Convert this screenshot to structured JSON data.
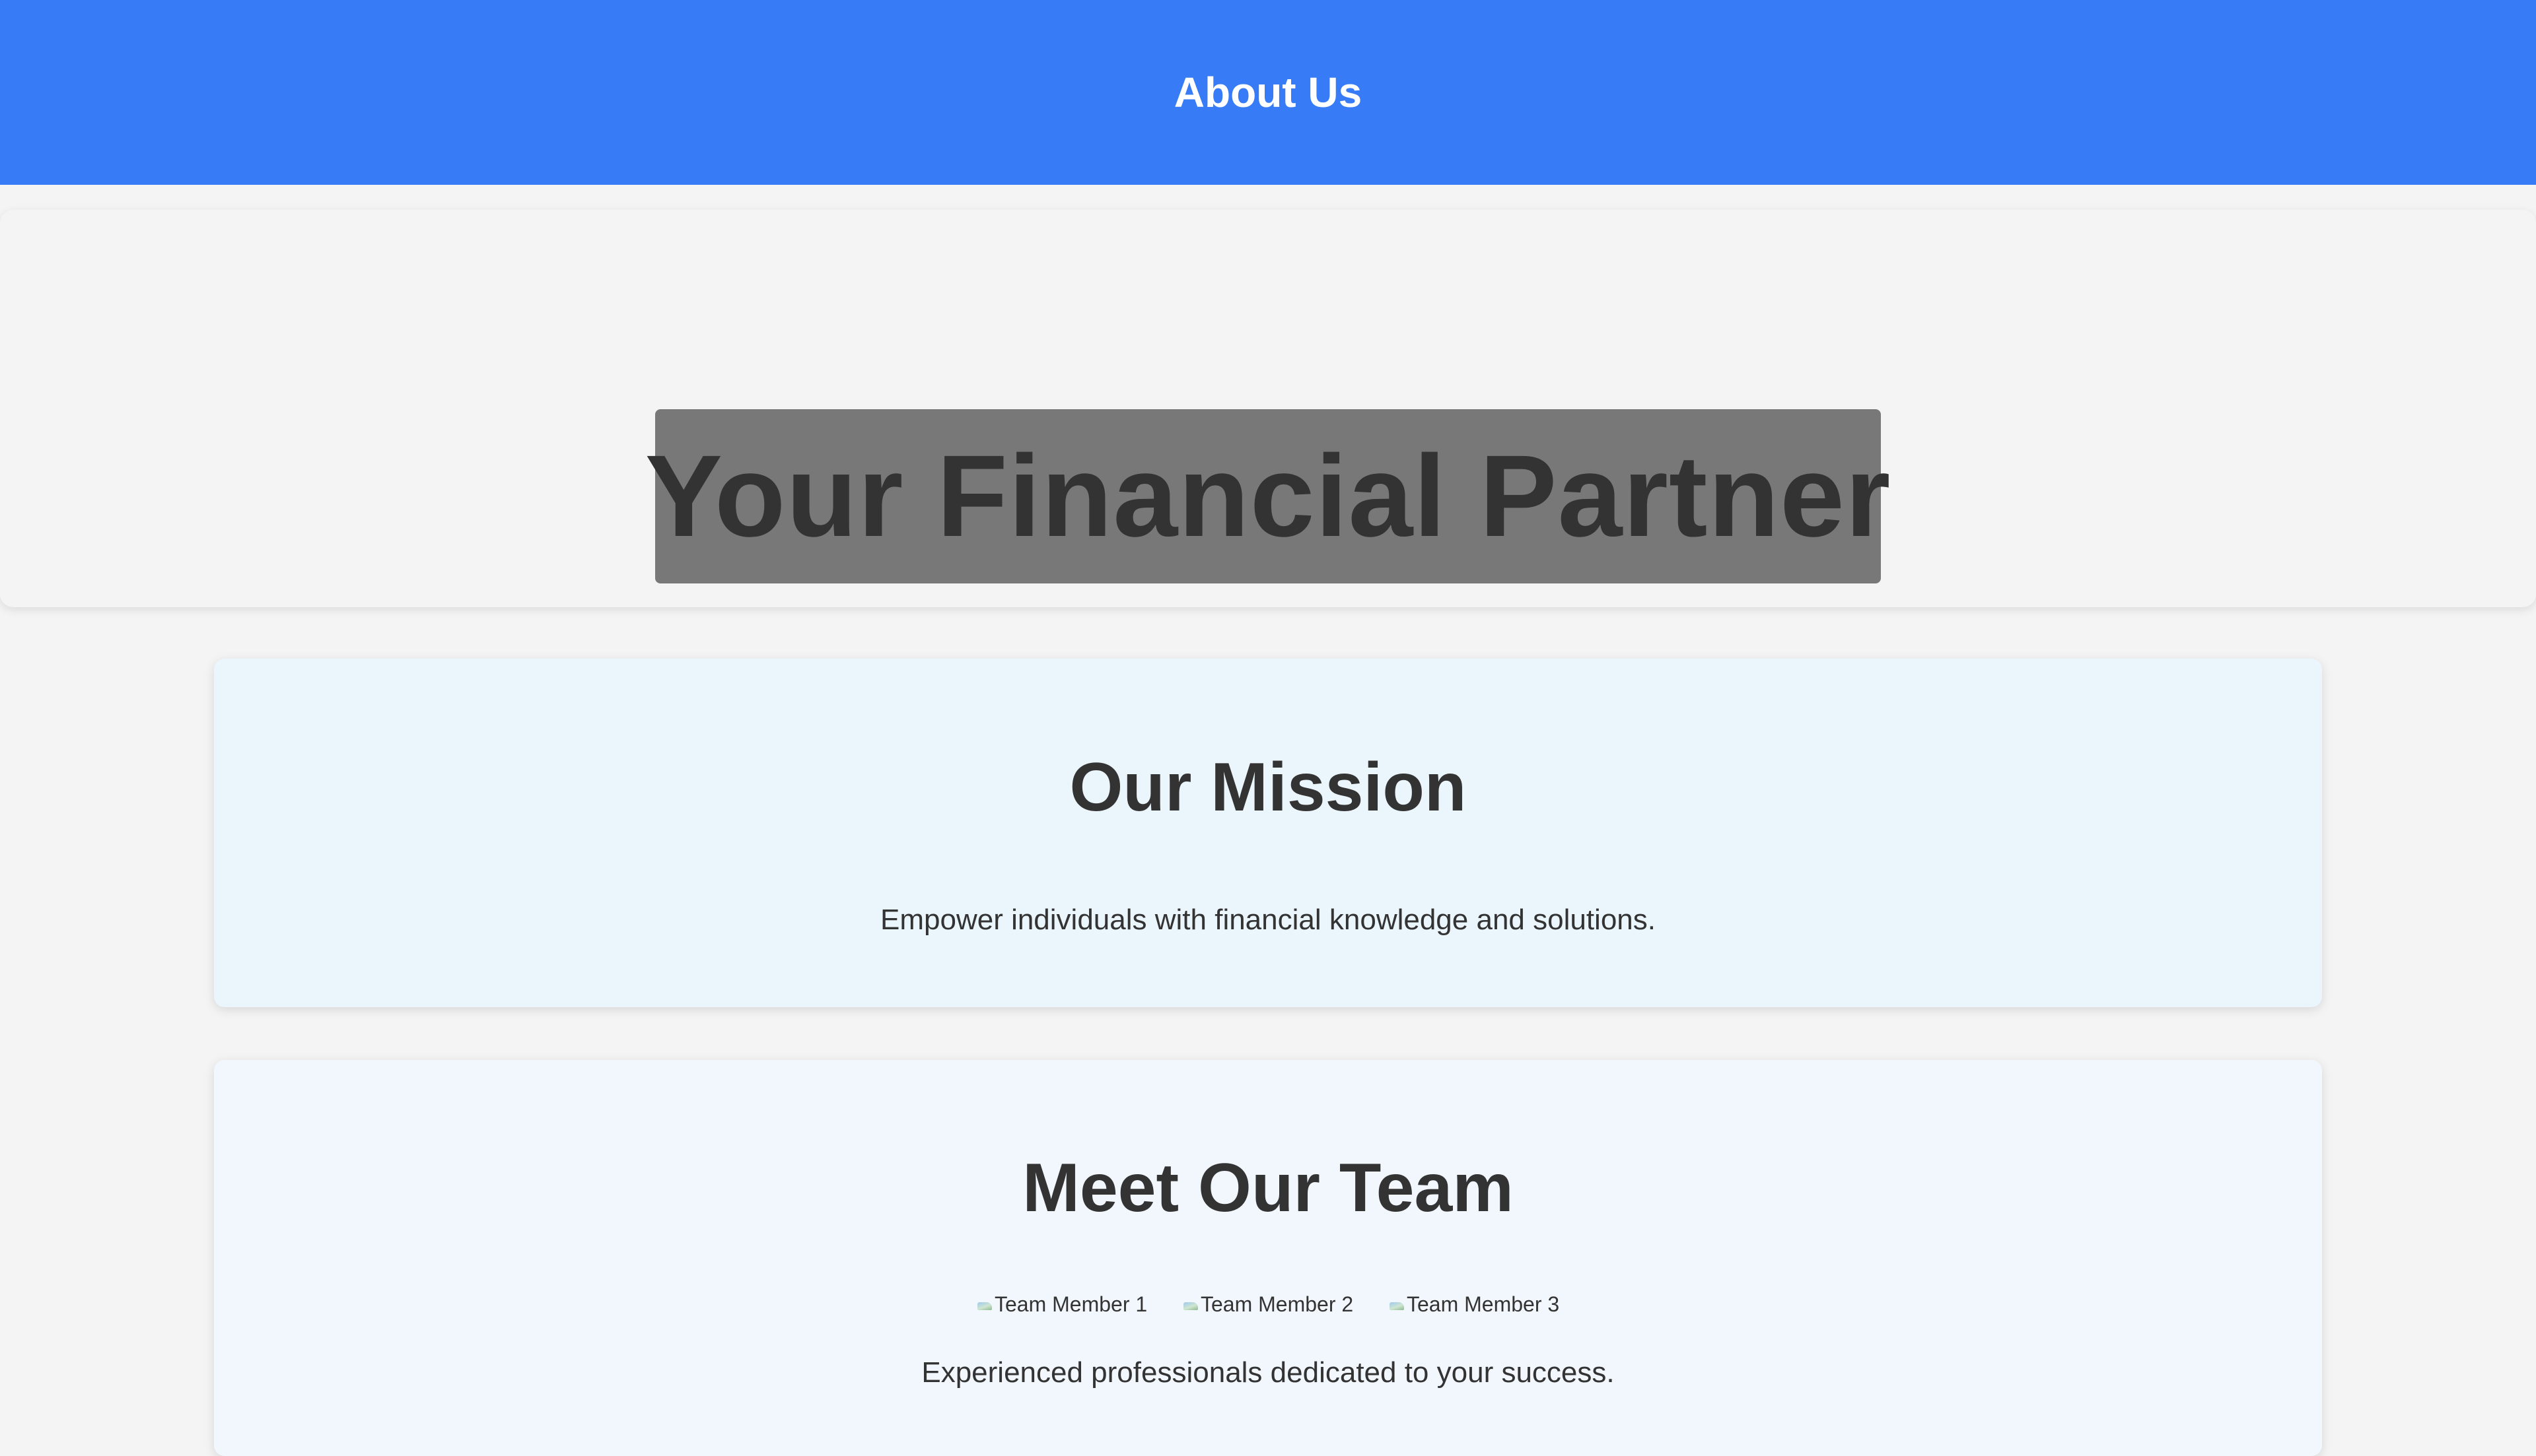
{
  "header": {
    "title": "About Us"
  },
  "hero": {
    "title": "Your Financial Partner"
  },
  "mission": {
    "heading": "Our Mission",
    "text": "Empower individuals with financial knowledge and solutions."
  },
  "team": {
    "heading": "Meet Our Team",
    "members": [
      {
        "alt": "Team Member 1",
        "icon": "broken-image-icon"
      },
      {
        "alt": "Team Member 2",
        "icon": "broken-image-icon"
      },
      {
        "alt": "Team Member 3",
        "icon": "broken-image-icon"
      }
    ],
    "text": "Experienced professionals dedicated to your success."
  },
  "colors": {
    "header_bg": "#377bf6",
    "page_bg": "#f4f4f4",
    "hero_banner_bg": "#787878",
    "mission_card_bg": "#ebf5fc",
    "team_card_bg": "#f2f7fe",
    "text": "#333333"
  }
}
